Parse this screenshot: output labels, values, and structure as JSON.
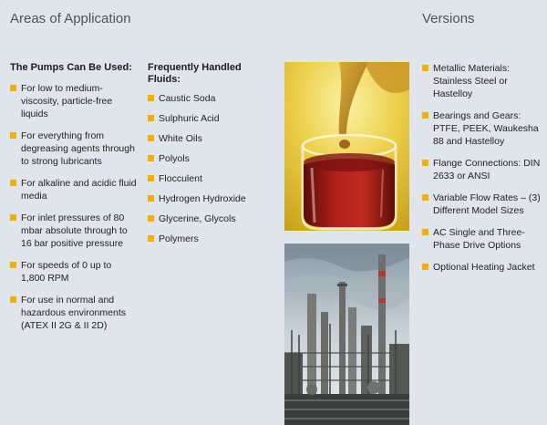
{
  "headings": {
    "areas": "Areas of Application",
    "versions": "Versions"
  },
  "pumps": {
    "title": "The Pumps Can Be Used:",
    "items": [
      "For low to medium-viscosity, particle-free liquids",
      "For everything from degreasing agents through to strong lubricants",
      "For alkaline and acidic fluid media",
      "For inlet pressures of 80 mbar absolute through to 16 bar positive pressure",
      "For speeds of 0 up to 1,800 RPM",
      "For use in normal and hazardous environments (ATEX II 2G & II 2D)"
    ]
  },
  "fluids": {
    "title": "Frequently Handled Fluids:",
    "items": [
      "Caustic Soda",
      "Sulphuric Acid",
      "White Oils",
      "Polyols",
      "Flocculent",
      "Hydrogen Hydroxide",
      "Glycerine, Glycols",
      "Polymers"
    ]
  },
  "versions": {
    "items": [
      "Metallic Materials: Stainless Steel or Hastelloy",
      "Bearings and Gears: PTFE, PEEK, Waukesha 88 and Hastelloy",
      "Flange Connections: DIN 2633 or ANSI",
      "Variable Flow Rates – (3) Different Model Sizes",
      "AC Single and Three-Phase Drive Options",
      "Optional Heating Jacket"
    ]
  },
  "colors": {
    "bullet": "#f2b000",
    "background": "#dfe5ea"
  }
}
